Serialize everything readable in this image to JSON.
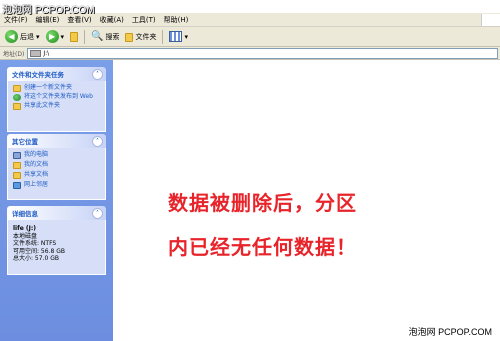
{
  "watermark_top": "泡泡网 PCPOP.COM",
  "menu": [
    "文件(F)",
    "编辑(E)",
    "查看(V)",
    "收藏(A)",
    "工具(T)",
    "帮助(H)"
  ],
  "toolbar": {
    "back": "后退",
    "search": "搜索",
    "folders": "文件夹"
  },
  "address": {
    "label": "地址(D)",
    "value": "J:\\"
  },
  "tasks_panel": {
    "title": "文件和文件夹任务",
    "items": [
      "创建一个新文件夹",
      "将这个文件夹发布到 Web",
      "共享此文件夹"
    ]
  },
  "places_panel": {
    "title": "其它位置",
    "items": [
      "我的电脑",
      "我的文档",
      "共享文档",
      "网上邻居"
    ]
  },
  "details_panel": {
    "title": "详细信息",
    "drive_name": "life (J:)",
    "drive_type": "本地磁盘",
    "fs": "文件系统: NTFS",
    "free": "可用空间: 56.8 GB",
    "total": "总大小: 57.0 GB"
  },
  "message": {
    "line1": "数据被删除后，分区",
    "line2": "内已经无任何数据！"
  },
  "watermark_bottom": "泡泡网 PCPOP.COM",
  "colors": {
    "accent_red": "#e8242b",
    "sidebar_blue": "#6d8ee0",
    "link_blue": "#215dc6"
  }
}
